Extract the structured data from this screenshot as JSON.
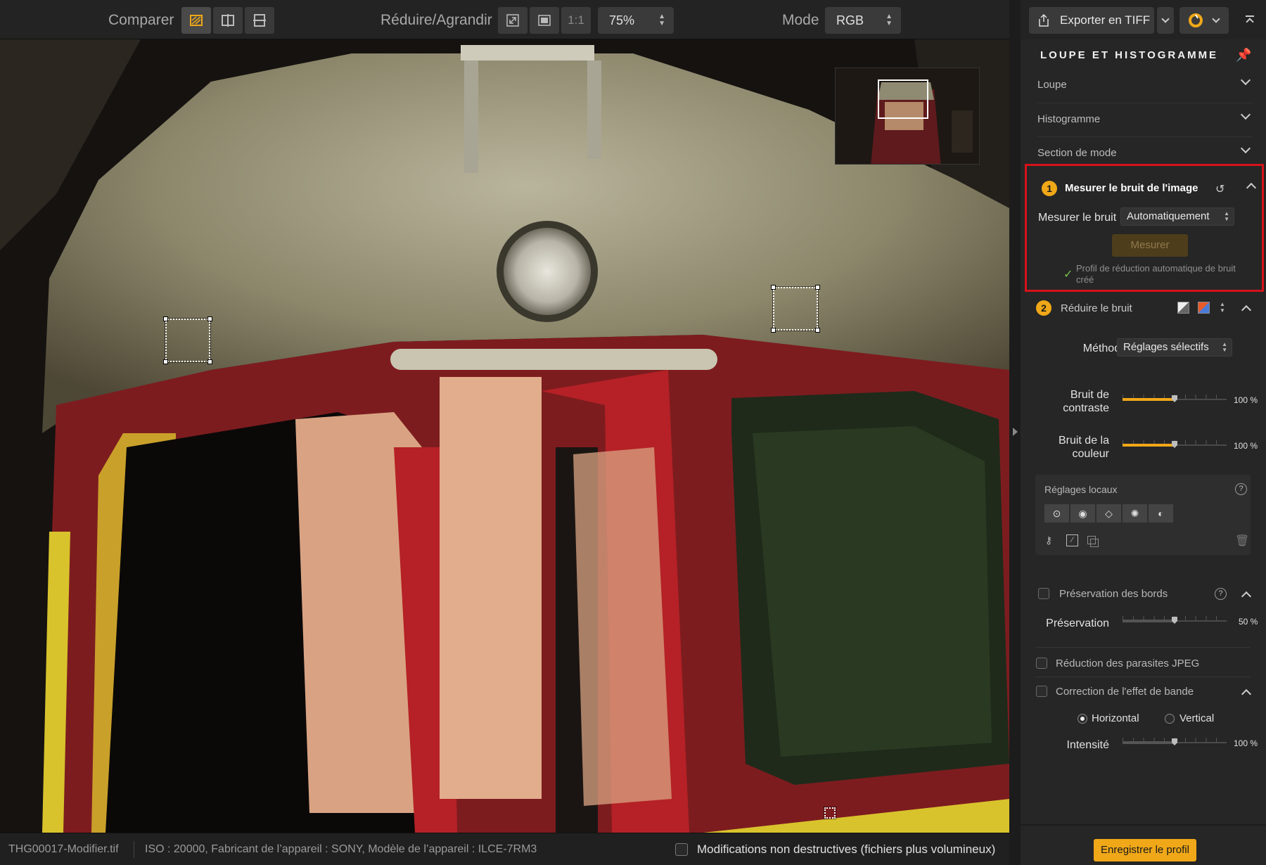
{
  "toolbar": {
    "compare_label": "Comparer",
    "resize_label": "Réduire/Agrandir",
    "one_to_one": "1:1",
    "zoom_value": "75%",
    "mode_label": "Mode",
    "mode_value": "RGB"
  },
  "status": {
    "filename": "THG00017-Modifier.tif",
    "metadata": "ISO : 20000, Fabricant de l’appareil : SONY, Modèle de l’appareil : ILCE-7RM3",
    "nondestructive_label": "Modifications non destructives (fichiers plus volumineux)"
  },
  "panel": {
    "export_label": "Exporter en TIFF",
    "title": "LOUPE ET HISTOGRAMME",
    "sections": {
      "loupe": "Loupe",
      "histogram": "Histogramme",
      "mode_section": "Section de mode"
    },
    "step1": {
      "number": "1",
      "title": "Mesurer le bruit de l'image",
      "measure_label": "Mesurer le bruit",
      "measure_value": "Automatiquement",
      "measure_button": "Mesurer",
      "profile_msg": "Profil de réduction automatique de bruit créé"
    },
    "step2": {
      "number": "2",
      "title": "Réduire le bruit",
      "method_label": "Méthode",
      "method_value": "Réglages sélectifs",
      "contrast_label": "Bruit de contraste",
      "contrast_value": "100 %",
      "contrast_level": 0.5,
      "color_label": "Bruit de la couleur",
      "color_value": "100 %",
      "color_level": 0.5
    },
    "local": {
      "title": "Réglages locaux",
      "help": "?"
    },
    "edges": {
      "title": "Préservation des bords",
      "help": "?",
      "preservation_label": "Préservation",
      "preservation_value": "50 %",
      "preservation_level": 0.5
    },
    "jpeg_label": "Réduction des parasites JPEG",
    "banding": {
      "title": "Correction de l'effet de bande",
      "horizontal": "Horizontal",
      "vertical": "Vertical",
      "intensity_label": "Intensité",
      "intensity_value": "100 %",
      "intensity_level": 0.5
    },
    "save_profile": "Enregistrer le profil"
  },
  "colors": {
    "accent": "#f0a818",
    "highlight": "#d6121a"
  }
}
